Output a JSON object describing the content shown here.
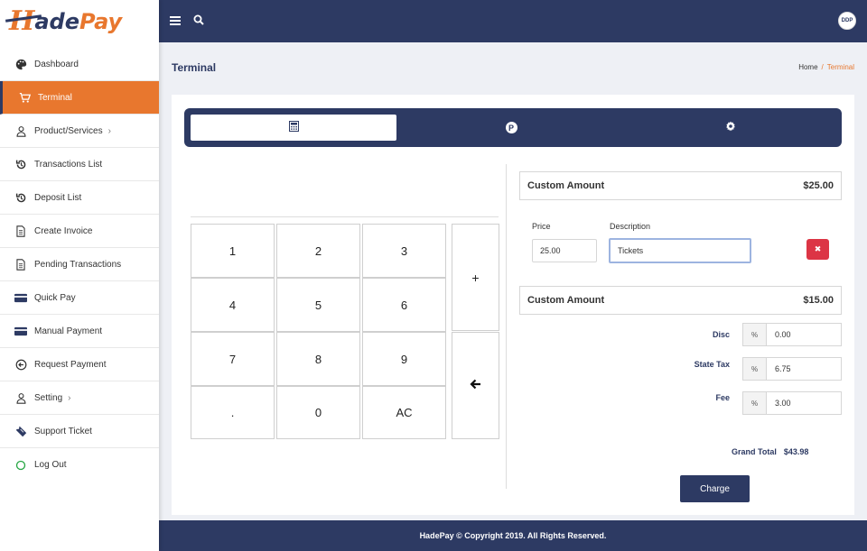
{
  "brand": {
    "logo_h": "H",
    "logo_rest_a": "ade",
    "logo_rest_b": "Pay"
  },
  "sidebar": {
    "items": [
      {
        "label": "Dashboard",
        "icon": "palette-icon"
      },
      {
        "label": "Terminal",
        "icon": "cart-icon",
        "active": true
      },
      {
        "label": "Product/Services",
        "icon": "user-icon",
        "chevron": true
      },
      {
        "label": "Transactions List",
        "icon": "history-icon"
      },
      {
        "label": "Deposit List",
        "icon": "history-icon"
      },
      {
        "label": "Create Invoice",
        "icon": "document-icon"
      },
      {
        "label": "Pending Transactions",
        "icon": "document-icon"
      },
      {
        "label": "Quick Pay",
        "icon": "credit-card-icon"
      },
      {
        "label": "Manual Payment",
        "icon": "credit-card-icon"
      },
      {
        "label": "Request Payment",
        "icon": "arrow-circle-icon"
      },
      {
        "label": "Setting",
        "icon": "user-icon",
        "chevron": true
      },
      {
        "label": "Support Ticket",
        "icon": "ticket-icon"
      },
      {
        "label": "Log Out",
        "icon": "circle-icon"
      }
    ]
  },
  "topbar": {
    "avatar_text": "DDP"
  },
  "header": {
    "title": "Terminal",
    "breadcrumb_home": "Home",
    "breadcrumb_sep": "/",
    "breadcrumb_current": "Terminal"
  },
  "tabs": [
    {
      "icon": "calculator-icon",
      "active": true
    },
    {
      "icon": "p-circle-icon",
      "label": "P"
    },
    {
      "icon": "gear-icon"
    }
  ],
  "keypad": {
    "keys": [
      "1",
      "2",
      "3",
      "4",
      "5",
      "6",
      "7",
      "8",
      "9",
      ".",
      "0",
      "AC"
    ],
    "plus": "+",
    "back": "🡐"
  },
  "items": [
    {
      "name": "Custom Amount",
      "amount": "$25.00"
    },
    {
      "name": "Custom Amount",
      "amount": "$15.00"
    }
  ],
  "edit": {
    "price_label": "Price",
    "price_value": "25.00",
    "description_label": "Description",
    "description_value": "Tickets",
    "delete_icon": "✖"
  },
  "fees": {
    "disc_label": "Disc",
    "disc_value": "0.00",
    "tax_label": "State Tax",
    "tax_value": "6.75",
    "fee_label": "Fee",
    "fee_value": "3.00",
    "unit": "%"
  },
  "total": {
    "label": "Grand Total",
    "value": "$43.98"
  },
  "charge_label": "Charge",
  "footer": "HadePay © Copyright 2019. All Rights Reserved.",
  "colors": {
    "navy": "#2d3a63",
    "orange": "#e8772e",
    "red": "#dc3545"
  }
}
